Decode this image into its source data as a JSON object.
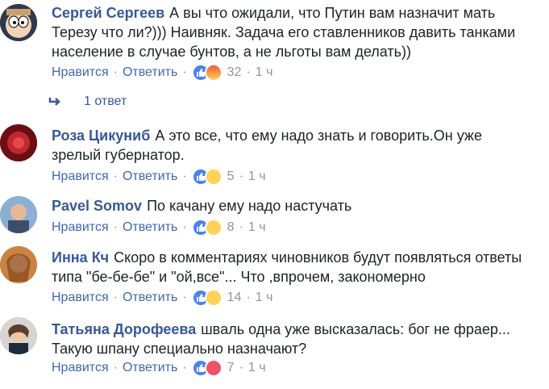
{
  "actions": {
    "like": "Нравится",
    "reply": "Ответить",
    "sep": "·"
  },
  "colors": {
    "link": "#4267b2",
    "author": "#385898",
    "meta": "#90949c"
  },
  "comments": [
    {
      "author": "Сергей Сергеев",
      "lines": [
        "А вы что ожидали, что Путин вам назначит мать",
        "Терезу что ли?))) Наивняк. Задача его ставленников давить танками",
        "население в случае бунтов, а не льготы вам делать))"
      ],
      "reactions": [
        "like-icon",
        "angry-icon"
      ],
      "count": "32",
      "time": "1 ч",
      "avatar": "cartoon-avatar"
    },
    {
      "author": "Роза Цикуниб",
      "lines": [
        "А это все, что ему надо знать и говорить.Он уже",
        "зрелый губернатор."
      ],
      "reactions": [
        "like-icon",
        "haha-icon"
      ],
      "count": "5",
      "time": "1 ч",
      "avatar": "red-avatar"
    },
    {
      "author": "Pavel Somov",
      "lines": [
        "По качану ему надо настучать"
      ],
      "reactions": [
        "like-icon",
        "haha-icon"
      ],
      "count": "8",
      "time": "1 ч",
      "avatar": "man-avatar"
    },
    {
      "author": "Инна Кч",
      "lines": [
        "Скоро в комментариях чиновников будут появляться ответы",
        "типа \"бе-бе-бе\" и \"ой,все\"... Что ,впрочем, закономерно"
      ],
      "reactions": [
        "like-icon",
        "haha-icon"
      ],
      "count": "14",
      "time": "1 ч",
      "avatar": "woman-avatar"
    },
    {
      "author": "Татьяна Дорофеева",
      "lines": [
        "швaль одна уже высказалась: бог не фраер...",
        "Такую шпану специально назначают?"
      ],
      "reactions": [
        "like-icon",
        "love-icon"
      ],
      "count": "7",
      "time": "1 ч",
      "avatar": "woman2-avatar"
    }
  ],
  "replies": {
    "label": "1 ответ",
    "icon": "reply-arrow-icon"
  }
}
